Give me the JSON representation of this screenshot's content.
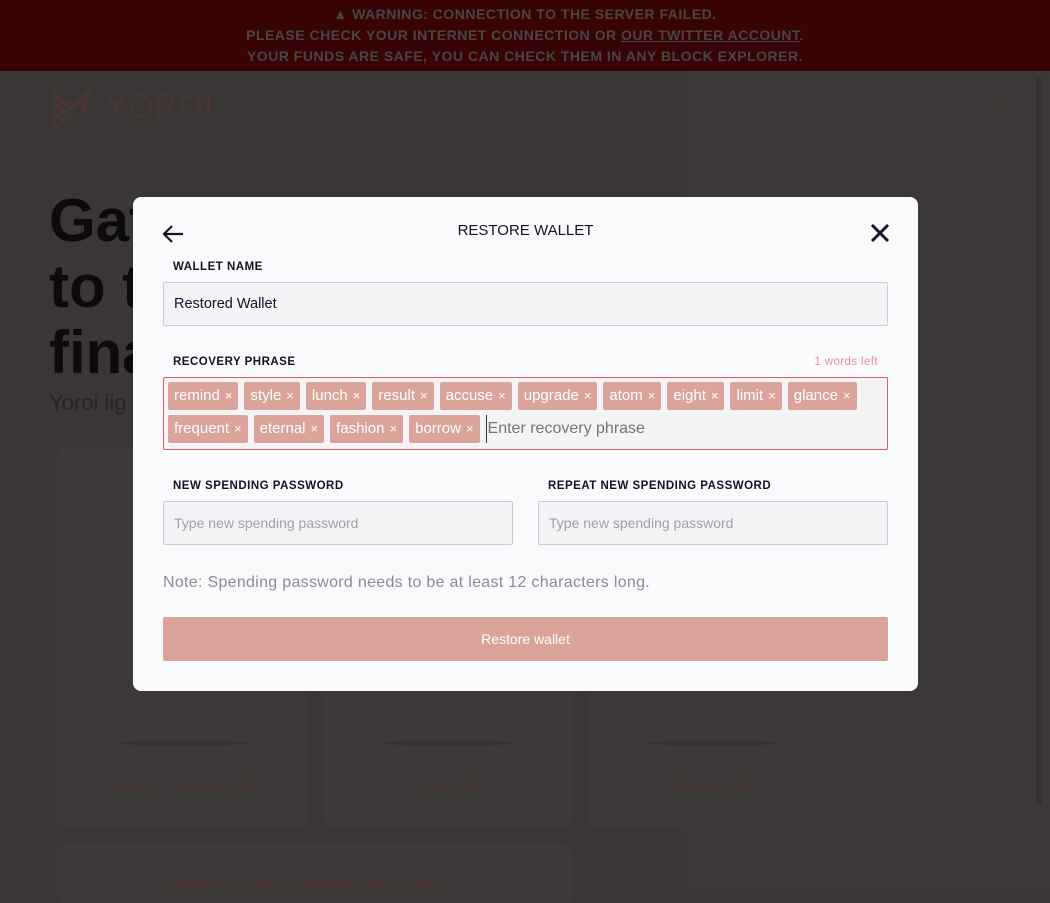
{
  "banner": {
    "line1": "WARNING: CONNECTION TO THE SERVER FAILED.",
    "line2_prefix": "PLEASE CHECK YOUR INTERNET CONNECTION OR ",
    "line2_link": "OUR TWITTER ACCOUNT",
    "line2_suffix": ".",
    "line3": "YOUR FUNDS ARE SAFE, YOU CAN CHECK THEM IN ANY BLOCK EXPLORER.",
    "icon": "warning-icon"
  },
  "logo": {
    "word": "YOROI",
    "sub": "wallet"
  },
  "background": {
    "hero_lines": [
      "Gat",
      "to t",
      "fina"
    ],
    "hero_sub": "Yoroi lig",
    "cards": [
      "Connect to hardware wallet",
      "Create wallet",
      "Restore wallet"
    ],
    "transfer": "Transfer funds from a Daedalus wallet to Yoroi"
  },
  "modal": {
    "title": "RESTORE WALLET",
    "wallet_name_label": "WALLET NAME",
    "wallet_name_value": "Restored Wallet",
    "recovery_label": "RECOVERY PHRASE",
    "words_left": "1 words left",
    "words": [
      "remind",
      "style",
      "lunch",
      "result",
      "accuse",
      "upgrade",
      "atom",
      "eight",
      "limit",
      "glance",
      "frequent",
      "eternal",
      "fashion",
      "borrow"
    ],
    "chip_remove": "×",
    "recovery_placeholder": "Enter recovery phrase",
    "new_password_label": "NEW SPENDING PASSWORD",
    "new_password_placeholder": "Type new spending password",
    "repeat_password_label": "REPEAT NEW SPENDING PASSWORD",
    "repeat_password_placeholder": "Type new spending password",
    "note": "Note: Spending password needs to be at least 12 characters long.",
    "submit": "Restore wallet"
  },
  "colors": {
    "accent": "#daa49a",
    "error": "#e05a66",
    "banner": "#380305"
  }
}
